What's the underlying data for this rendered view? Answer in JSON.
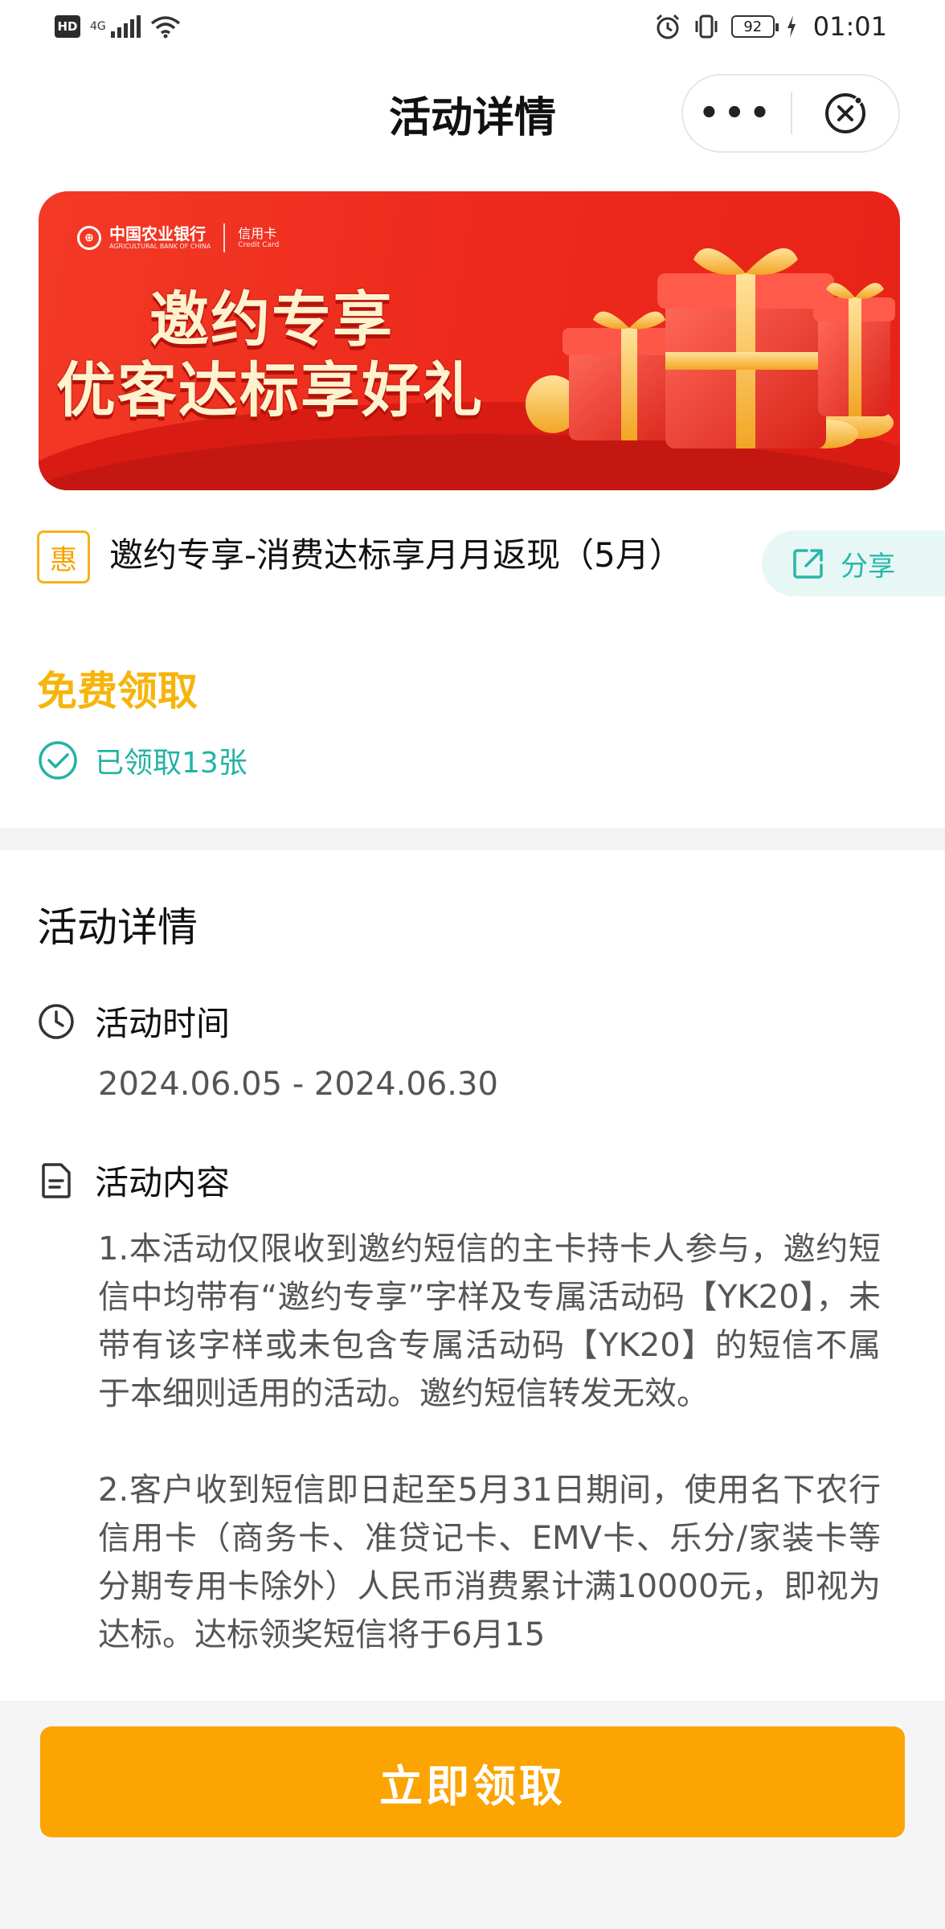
{
  "status_bar": {
    "hd": "HD",
    "network": "4G",
    "battery": "92",
    "time": "01:01"
  },
  "nav": {
    "title": "活动详情",
    "more_glyph": "•••"
  },
  "banner": {
    "bank_name": "中国农业银行",
    "bank_name_en": "AGRICULTURAL BANK OF CHINA",
    "card_label": "信用卡",
    "card_label_en": "Credit Card",
    "headline_1": "邀约专享",
    "headline_2": "优客达标享好礼"
  },
  "activity": {
    "tag": "惠",
    "title": "邀约专享-消费达标享月月返现（5月）",
    "share_label": "分享",
    "price_label": "免费领取",
    "claimed_text": "已领取13张"
  },
  "details": {
    "section_title": "活动详情",
    "time_heading": "活动时间",
    "date_range": "2024.06.05 - 2024.06.30",
    "content_heading": "活动内容",
    "paragraphs": [
      "1.本活动仅限收到邀约短信的主卡持卡人参与，邀约短信中均带有“邀约专享”字样及专属活动码【YK20】，未带有该字样或未包含专属活动码【YK20】的短信不属于本细则适用的活动。邀约短信转发无效。",
      "2.客户收到短信即日起至5月31日期间，使用名下农行信用卡（商务卡、准贷记卡、EMV卡、乐分/家装卡等分期专用卡除外）人民币消费累计满10000元，即视为达标。达标领奖短信将于6月15"
    ]
  },
  "footer": {
    "claim_button": "立即领取"
  },
  "colors": {
    "accent_orange": "#fba402",
    "teal": "#22b3a4",
    "banner_red": "#ee2b1d",
    "price_yellow": "#f6b50c"
  }
}
